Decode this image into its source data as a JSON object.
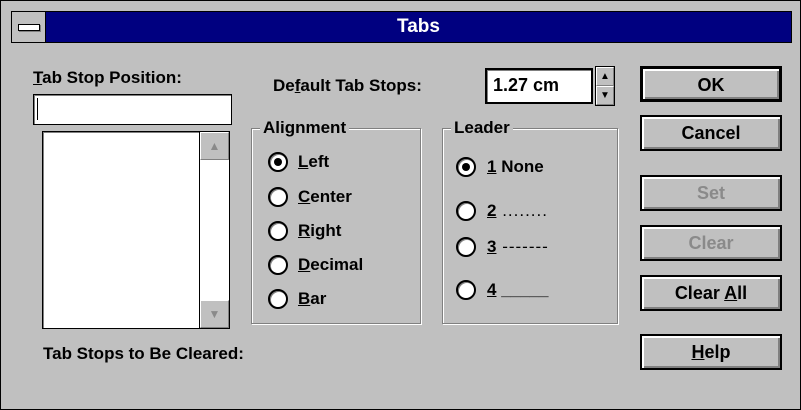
{
  "window": {
    "title": "Tabs"
  },
  "tab_stop_position": {
    "label_key": "T",
    "label_rest": "ab Stop Position:",
    "value": ""
  },
  "default_tab_stops": {
    "label_pre": "De",
    "label_key": "f",
    "label_rest": "ault Tab Stops:",
    "value": "1.27 cm"
  },
  "alignment": {
    "legend": "Alignment",
    "options": [
      {
        "key": "L",
        "rest": "eft",
        "selected": true
      },
      {
        "key": "C",
        "rest": "enter",
        "selected": false
      },
      {
        "key": "R",
        "rest": "ight",
        "selected": false
      },
      {
        "key": "D",
        "rest": "ecimal",
        "selected": false
      },
      {
        "key": "B",
        "rest": "ar",
        "selected": false
      }
    ]
  },
  "leader": {
    "legend": "Leader",
    "options": [
      {
        "key": "1",
        "rest": " None",
        "selected": true
      },
      {
        "key": "2",
        "rest": " ........",
        "selected": false
      },
      {
        "key": "3",
        "rest": " -------",
        "selected": false
      },
      {
        "key": "4",
        "rest": " _____",
        "selected": false
      }
    ]
  },
  "buttons": {
    "ok": "OK",
    "cancel": "Cancel",
    "set": "Set",
    "clear": "Clear",
    "clear_all_pre": "Clear ",
    "clear_all_key": "A",
    "clear_all_rest": "ll",
    "help_key": "H",
    "help_rest": "elp"
  },
  "tab_stops_to_be_cleared": {
    "label": "Tab Stops to Be Cleared:"
  },
  "icons": {
    "system_menu": "system-menu-icon",
    "scroll_up": "scroll-up-arrow-icon",
    "scroll_down": "scroll-down-arrow-icon",
    "spin_up": "spin-up-arrow-icon",
    "spin_down": "spin-down-arrow-icon"
  }
}
